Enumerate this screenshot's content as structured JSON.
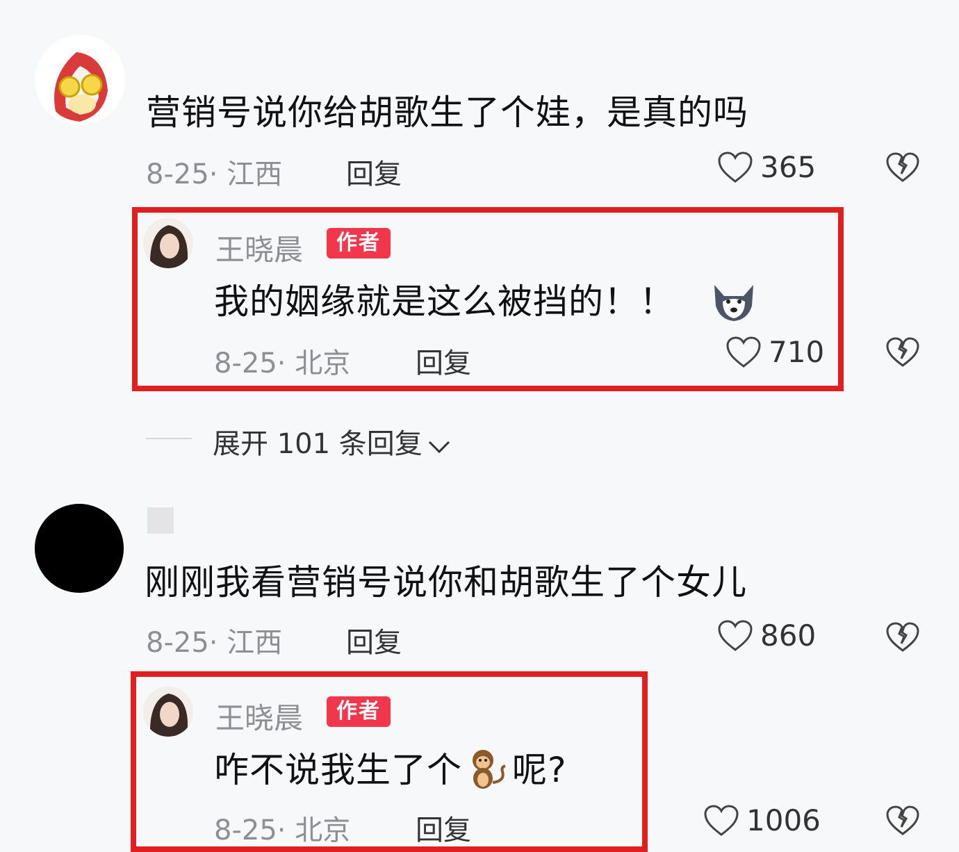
{
  "comments": [
    {
      "avatar_icon": "cartoon-hero-avatar",
      "text": "营销号说你给胡歌生了个娃，是真的吗",
      "meta": "8-25· 江西",
      "reply_label": "回复",
      "likes": "365",
      "author_reply": {
        "name": "王晓晨",
        "badge": "作者",
        "text": "我的姻缘就是这么被挡的！！",
        "emoji_icon": "husky-dog-emoji",
        "meta": "8-25· 北京",
        "reply_label": "回复",
        "likes": "710"
      },
      "expand_label": "展开 101 条回复"
    },
    {
      "avatar_icon": "black-circle-avatar",
      "text": "刚刚我看营销号说你和胡歌生了个女儿",
      "meta": "8-25· 江西",
      "reply_label": "回复",
      "likes": "860",
      "author_reply": {
        "name": "王晓晨",
        "badge": "作者",
        "text_before": "咋不说我生了个",
        "emoji_icon": "monkey-emoji",
        "text_after": "呢?",
        "meta": "8-25· 北京",
        "reply_label": "回复",
        "likes": "1006"
      }
    }
  ],
  "colors": {
    "highlight": "#e02020",
    "badge": "#f2364c",
    "meta_text": "#8e8e93"
  }
}
